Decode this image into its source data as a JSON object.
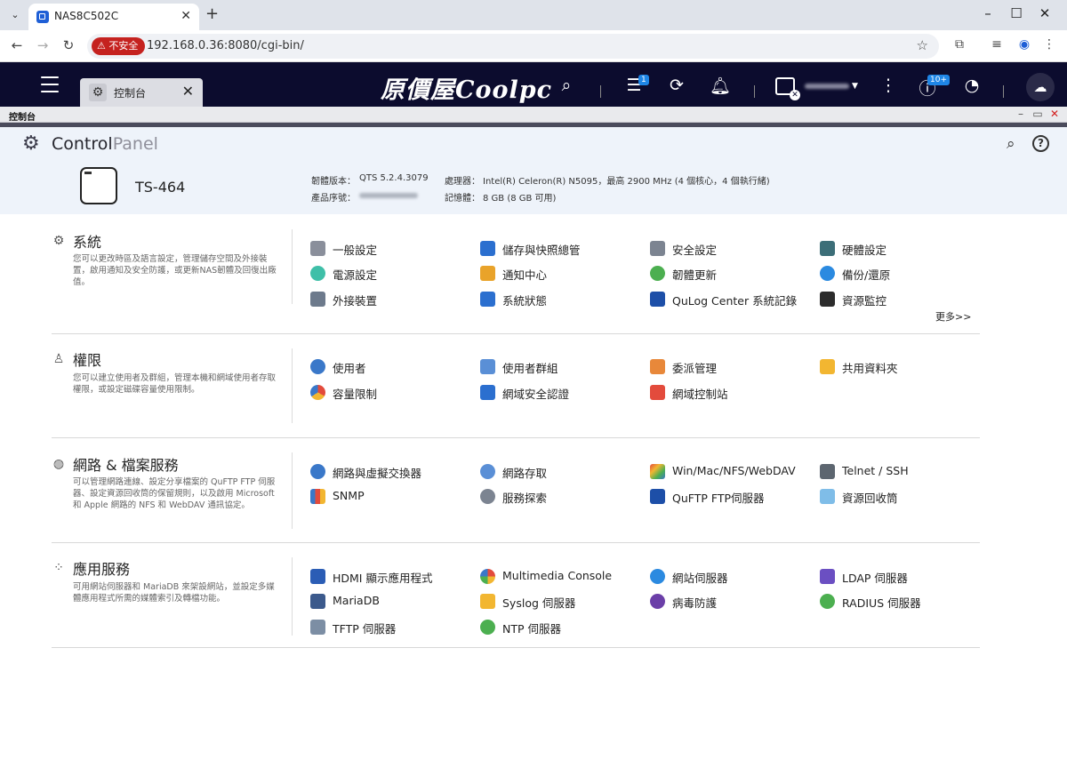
{
  "browser": {
    "tab_title": "NAS8C502C",
    "insecure_label": "不安全",
    "url": "192.168.0.36:8080/cgi-bin/"
  },
  "qts": {
    "app_tab_label": "控制台",
    "brand_text": "原價屋Coolpc",
    "badge_tasks": "1",
    "badge_info": "10+"
  },
  "window": {
    "title": "控制台"
  },
  "header": {
    "title_bold": "Control",
    "title_light": "Panel",
    "model": "TS-464",
    "firmware_label": "韌體版本：",
    "firmware_value": "QTS 5.2.4.3079",
    "serial_label": "產品序號：",
    "cpu_label": "處理器：",
    "cpu_value": "Intel(R) Celeron(R) N5095，最高 2900 MHz (4 個核心，4 個執行緒)",
    "memory_label": "記憶體：",
    "memory_value": "8 GB (8 GB 可用)"
  },
  "sections": {
    "system": {
      "title": "系統",
      "desc": "您可以更改時區及語言設定，管理儲存空間及外接裝置，啟用通知及安全防護，或更新NAS韌體及回復出廠值。",
      "more": "更多>>",
      "items": [
        "一般設定",
        "儲存與快照總管",
        "安全設定",
        "硬體設定",
        "電源設定",
        "通知中心",
        "韌體更新",
        "備份/還原",
        "外接裝置",
        "系統狀態",
        "QuLog Center 系統記錄",
        "資源監控"
      ]
    },
    "privilege": {
      "title": "權限",
      "desc": "您可以建立使用者及群組，管理本機和網域使用者存取權限，或設定磁碟容量使用限制。",
      "items": [
        "使用者",
        "使用者群組",
        "委派管理",
        "共用資料夾",
        "容量限制",
        "網域安全認證",
        "網域控制站"
      ]
    },
    "network": {
      "title": "網路 & 檔案服務",
      "desc": "可以管理網路連線、設定分享檔案的 QuFTP FTP 伺服器、設定資源回收筒的保留規則，以及啟用 Microsoft 和 Apple 網路的 NFS 和 WebDAV 通訊協定。",
      "items": [
        "網路與虛擬交換器",
        "網路存取",
        "Win/Mac/NFS/WebDAV",
        "Telnet / SSH",
        "SNMP",
        "服務探索",
        "QuFTP FTP伺服器",
        "資源回收筒"
      ]
    },
    "apps": {
      "title": "應用服務",
      "desc": "可用網站伺服器和 MariaDB 來架設網站，並設定多媒體應用程式所需的媒體索引及轉檔功能。",
      "items": [
        "HDMI 顯示應用程式",
        "Multimedia Console",
        "網站伺服器",
        "LDAP 伺服器",
        "MariaDB",
        "Syslog 伺服器",
        "病毒防護",
        "RADIUS 伺服器",
        "TFTP 伺服器",
        "NTP 伺服器"
      ]
    }
  },
  "colors": {
    "qts_bar": "#0c0c2e",
    "header_bg": "#eef3fa",
    "accent": "#1f86e6",
    "insecure": "#c5221f"
  }
}
